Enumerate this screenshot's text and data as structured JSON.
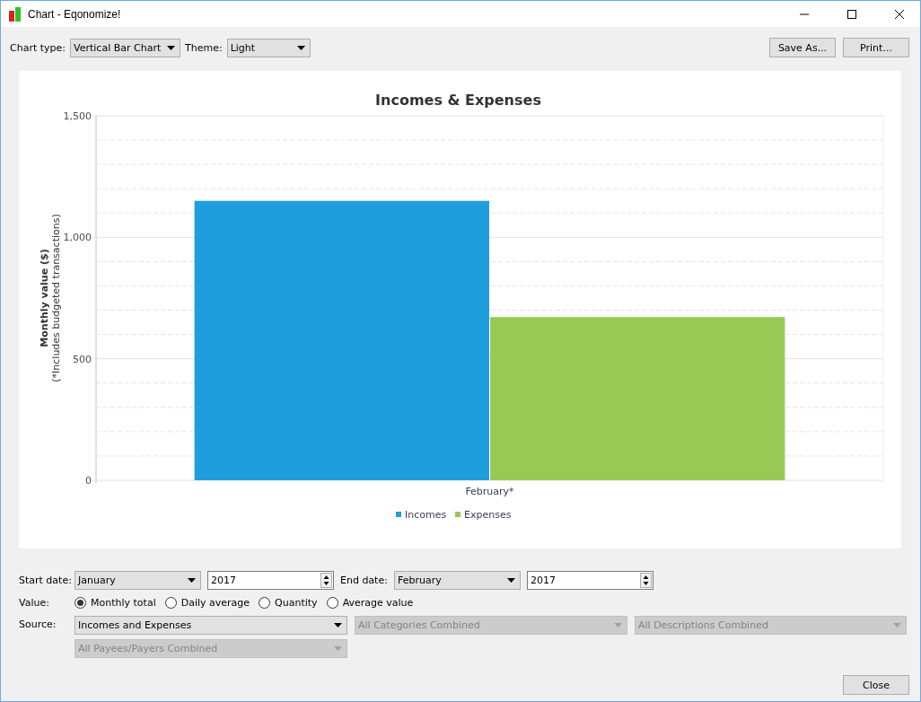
{
  "window": {
    "title": "Chart - Eqonomize!"
  },
  "toolbar": {
    "chart_type": {
      "label": "Chart type:",
      "value": "Vertical Bar Chart"
    },
    "theme": {
      "label": "Theme:",
      "value": "Light"
    },
    "buttons": [
      "Save As...",
      "Print..."
    ]
  },
  "chart": {
    "ylabel_note": "(*Includes budgeted transactions)",
    "chart_data": {
      "type": "bar",
      "title": "Incomes & Expenses",
      "ylabel": "Monthly value ($)",
      "categories": [
        "February*"
      ],
      "series": [
        {
          "name": "Incomes",
          "color": "#1f9ede",
          "values": [
            1150
          ]
        },
        {
          "name": "Expenses",
          "color": "#98c954",
          "values": [
            672
          ]
        }
      ],
      "legend": true,
      "ylim": [
        0,
        1500
      ],
      "yticks": [
        0,
        500,
        {
          "value": 1000,
          "label": "1,000"
        },
        {
          "value": 1500,
          "label": "1,500"
        }
      ]
    }
  },
  "form": {
    "start_date": {
      "label": "Start date:",
      "month": "January",
      "year": "2017"
    },
    "end_date": {
      "label": "End date:",
      "month": "February",
      "year": "2017"
    },
    "value": {
      "label": "Value:",
      "options": [
        {
          "label": "Monthly total",
          "selected": true
        },
        {
          "label": "Daily average",
          "selected": false
        },
        {
          "label": "Quantity",
          "selected": false
        },
        {
          "label": "Average value",
          "selected": false
        }
      ]
    },
    "source": {
      "label": "Source:",
      "selects": [
        {
          "value": "Incomes and Expenses",
          "disabled": false
        },
        {
          "value": "All Categories Combined",
          "disabled": true
        },
        {
          "value": "All Descriptions Combined",
          "disabled": true
        },
        {
          "value": "All Payees/Payers Combined",
          "disabled": true
        }
      ]
    }
  },
  "close_button": "Close"
}
